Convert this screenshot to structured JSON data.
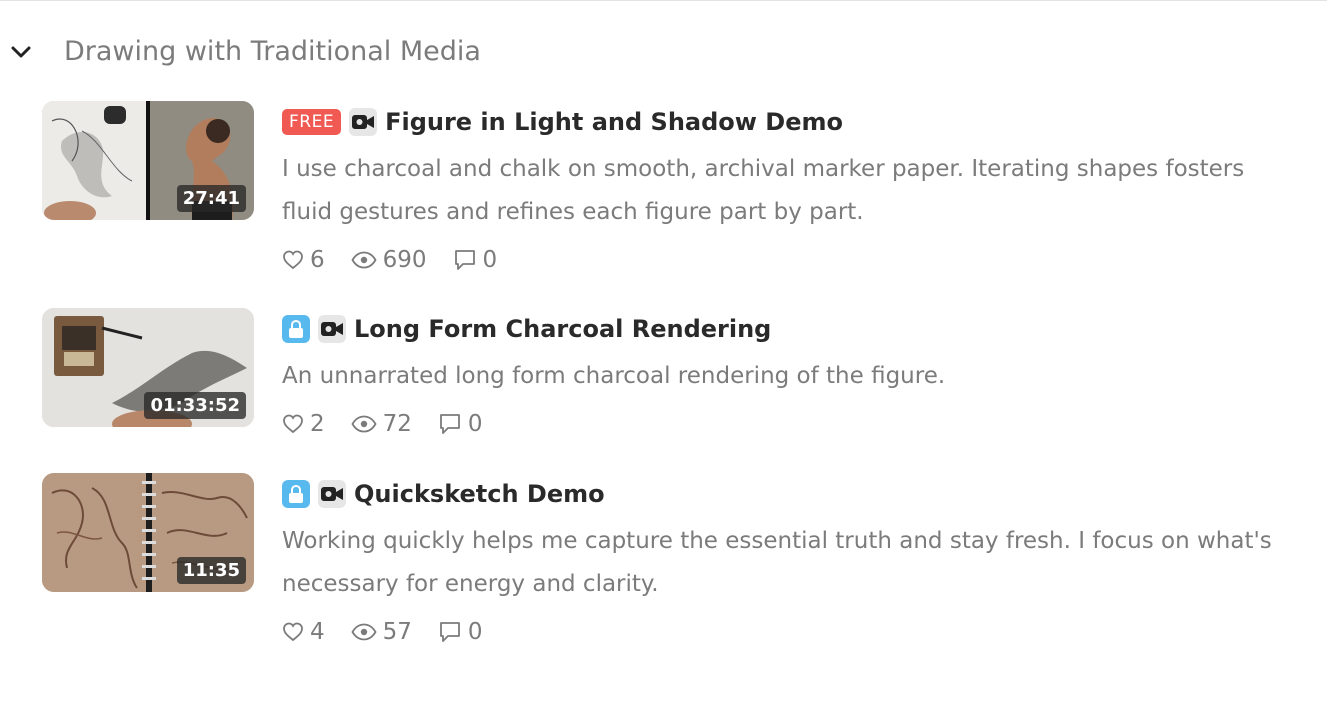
{
  "section": {
    "title": "Drawing with Traditional Media"
  },
  "lessons": [
    {
      "badge": "FREE",
      "title": "Figure in Light and Shadow Demo",
      "description": "I use charcoal and chalk on smooth, archival marker paper. Iterating shapes fosters fluid gestures and refines each figure part by part.",
      "duration": "27:41",
      "likes": "6",
      "views": "690",
      "comments": "0"
    },
    {
      "badge": "",
      "title": "Long Form Charcoal Rendering",
      "description": "An unnarrated long form charcoal rendering of the figure.",
      "duration": "01:33:52",
      "likes": "2",
      "views": "72",
      "comments": "0"
    },
    {
      "badge": "",
      "title": "Quicksketch Demo",
      "description": "Working quickly helps me capture the essential truth and stay fresh. I focus on what's necessary for energy and clarity.",
      "duration": "11:35",
      "likes": "4",
      "views": "57",
      "comments": "0"
    }
  ],
  "icons": {
    "collapse": "chevron-down-icon",
    "lock": "lock-icon",
    "video": "video-camera-icon",
    "like": "heart-icon",
    "view": "eye-icon",
    "comment": "speech-bubble-icon"
  },
  "colors": {
    "free_badge": "#f05a53",
    "lock_badge": "#58b9ef",
    "muted_text": "#7b7b7b",
    "title_text": "#2a2a2a"
  }
}
